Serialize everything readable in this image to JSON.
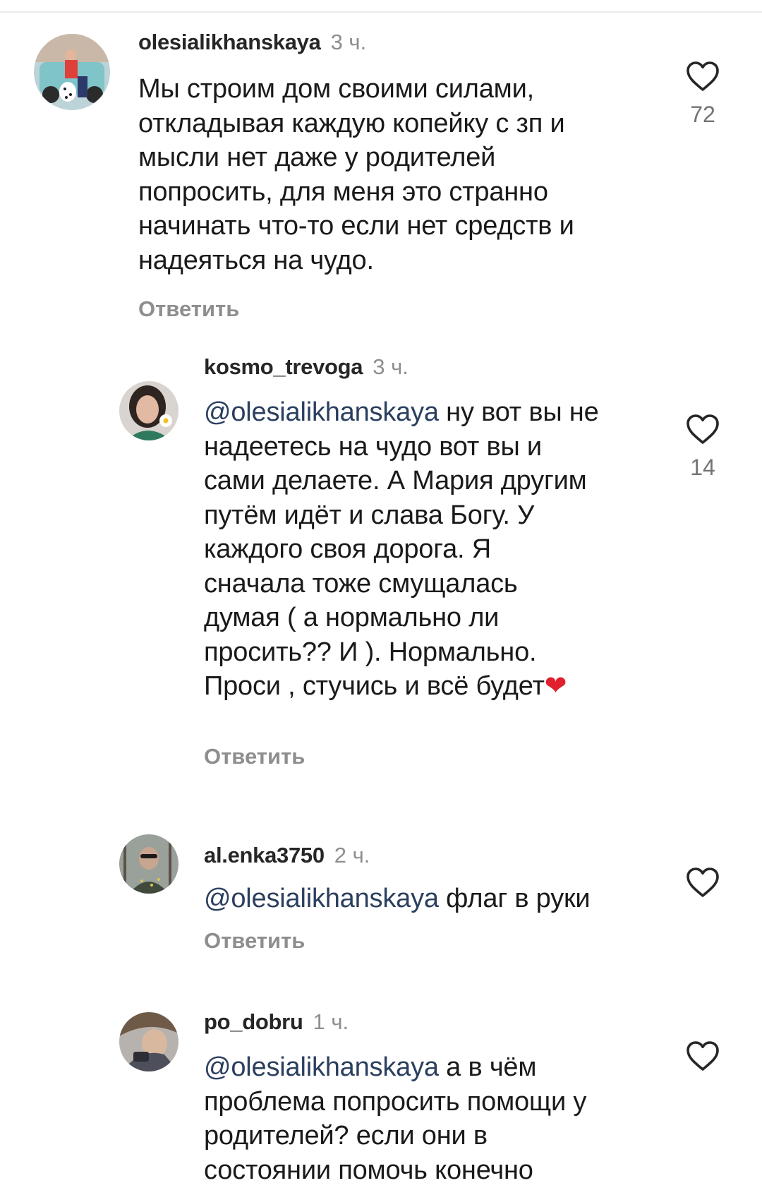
{
  "comments": [
    {
      "username": "olesialikhanskaya",
      "time": "3 ч.",
      "mention": "",
      "lines": [
        "Мы строим дом своими силами,",
        "откладывая каждую копейку с зп и",
        "мысли нет даже у родителей",
        "попросить, для меня это странно",
        "начинать что-то если нет средств и",
        "надеяться на чудо."
      ],
      "reply_label": "Ответить",
      "likes": "72",
      "avatar_icon": "avatar-photo-icon"
    },
    {
      "username": "kosmo_trevoga",
      "time": "3 ч.",
      "mention": "@olesialikhanskaya",
      "first_line_rest": " ну вот вы не",
      "lines": [
        "надеетесь на чудо вот вы и",
        "сами делаете. А Мария другим",
        "путём идёт и слава Богу.  У",
        "каждого своя дорога. Я",
        "сначала тоже смущалась",
        "думая ( а нормально ли",
        "просить?? И ). Нормально.",
        "Проси , стучись и всё будет"
      ],
      "emoji": "❤",
      "reply_label": "Ответить",
      "likes": "14",
      "avatar_icon": "avatar-photo-icon"
    },
    {
      "username": "al.enka3750",
      "time": "2 ч.",
      "mention": "@olesialikhanskaya",
      "first_line_rest": " флаг в руки",
      "lines": [],
      "reply_label": "Ответить",
      "likes": "",
      "avatar_icon": "avatar-photo-icon"
    },
    {
      "username": "po_dobru",
      "time": "1 ч.",
      "mention": "@olesialikhanskaya",
      "first_line_rest": " а в чём",
      "lines": [
        "проблема попросить помощи у",
        "родителей? если они в",
        "состоянии помочь конечно"
      ],
      "likes": "",
      "avatar_icon": "avatar-photo-icon"
    }
  ],
  "colors": {
    "username": "#262626",
    "muted": "#8e8e8e",
    "mention": "#2b3f5f",
    "heart_outline": "#262626",
    "emoji_heart": "#e0202c"
  },
  "icons": {
    "like": "heart-outline-icon"
  }
}
